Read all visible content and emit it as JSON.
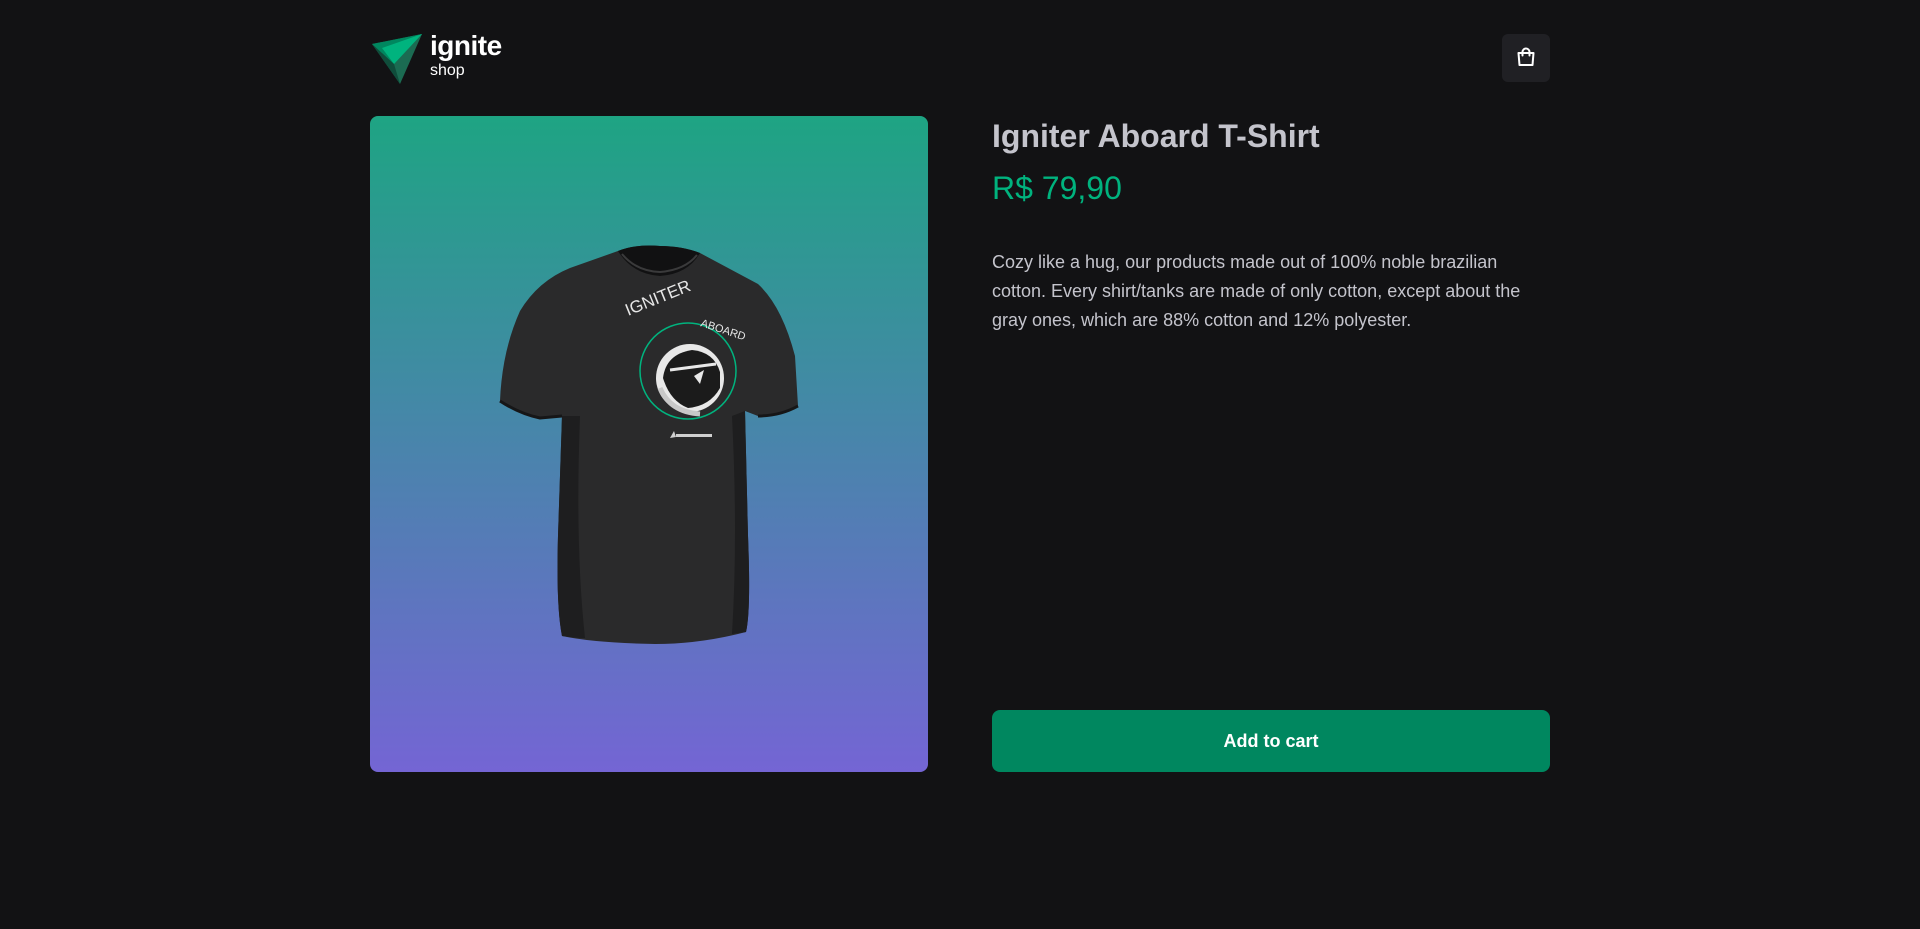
{
  "header": {
    "logo_title": "ignite",
    "logo_subtitle": "shop",
    "cart_icon": "shopping-bag-icon"
  },
  "product": {
    "name": "Igniter Aboard T-Shirt",
    "price": "R$ 79,90",
    "description": "Cozy like a hug, our products made out of 100% noble brazilian cotton. Every shirt/tanks are made of only cotton, except about the gray ones, which are 88% cotton and 12% polyester.",
    "image_text_main": "IGNITER",
    "image_text_secondary": "ABOARD",
    "add_to_cart_label": "Add to cart"
  },
  "colors": {
    "background": "#121214",
    "brand_green": "#00875f",
    "price_green": "#00b37e",
    "gradient_top": "#1ea483",
    "gradient_bottom": "#7465d4"
  }
}
